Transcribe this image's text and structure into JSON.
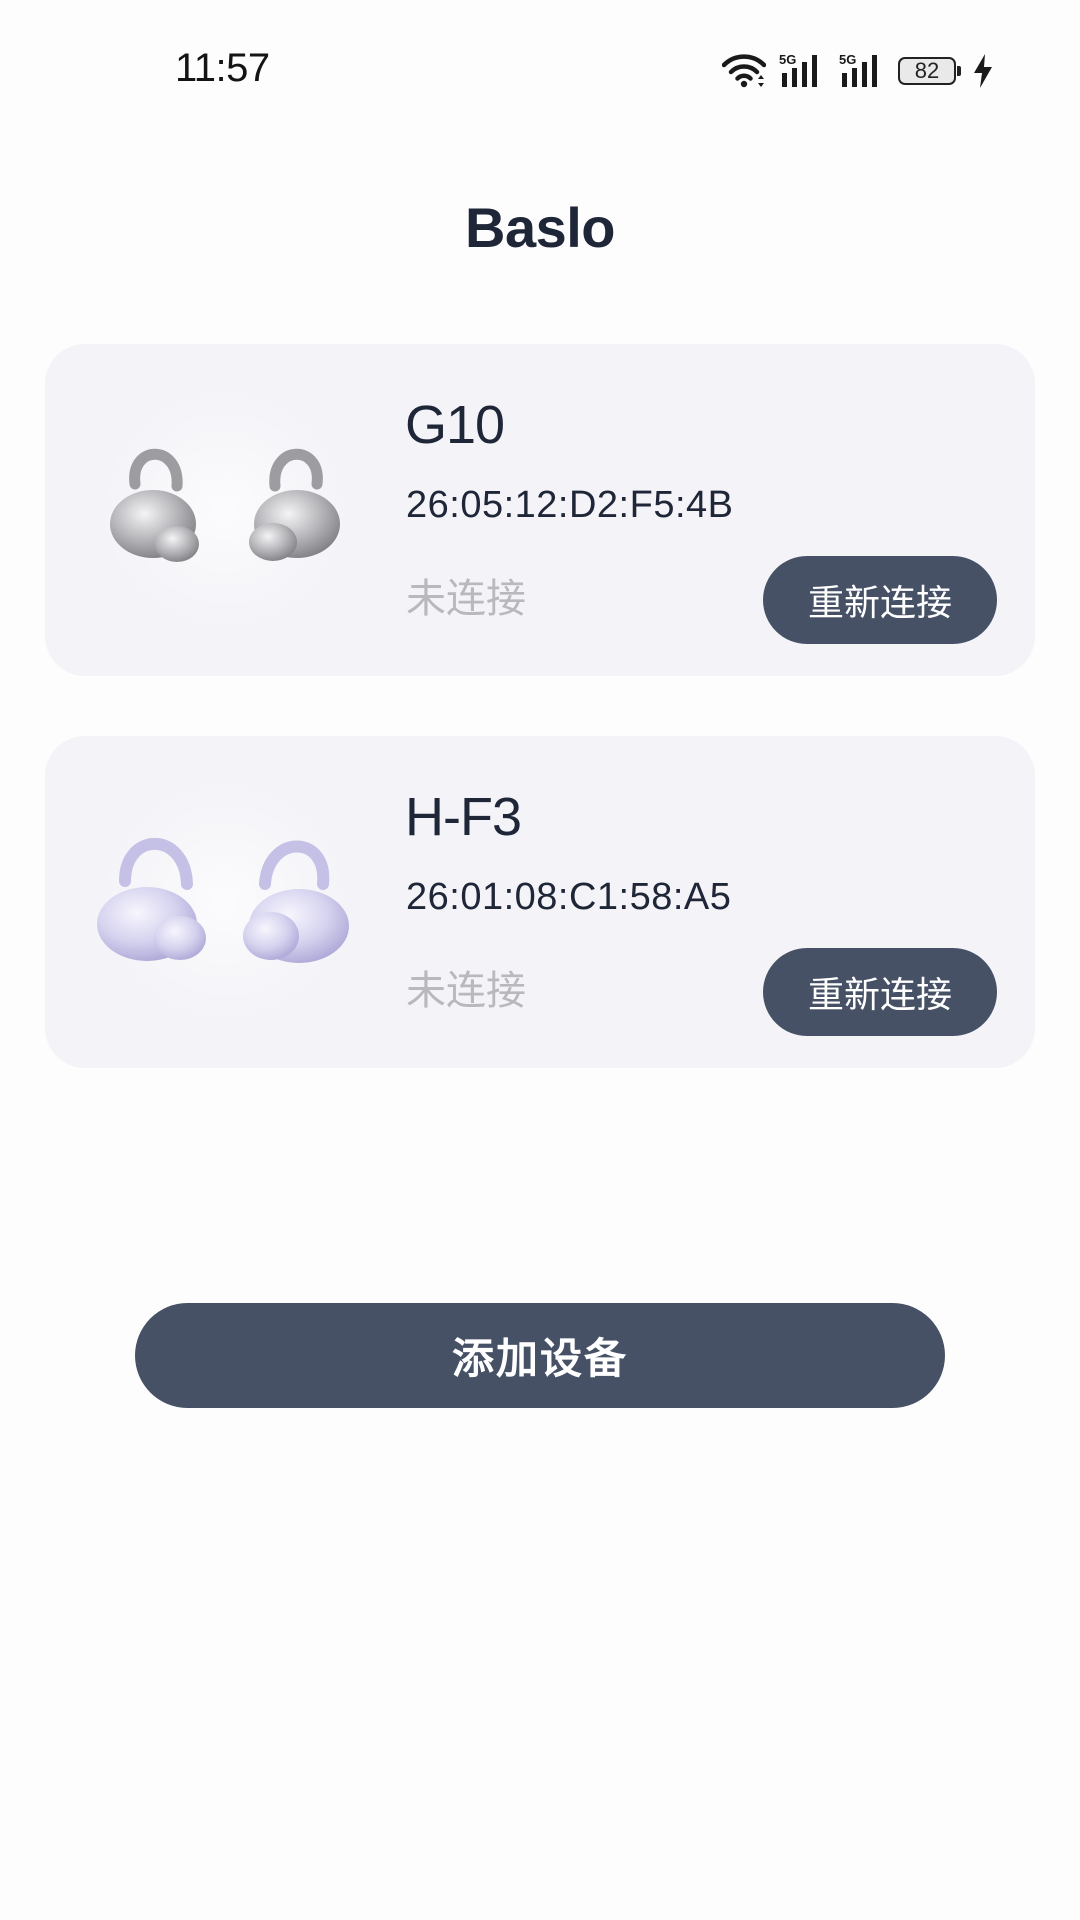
{
  "status_bar": {
    "time": "11:57",
    "signal_1_label": "5G",
    "signal_2_label": "5G",
    "battery_level": "82",
    "icons": [
      "wifi-icon",
      "signal-5g-icon",
      "signal-5g-icon",
      "battery-icon",
      "charging-icon"
    ]
  },
  "app": {
    "title": "Baslo"
  },
  "devices": [
    {
      "name": "G10",
      "mac": "26:05:12:D2:F5:4B",
      "status": "未连接",
      "button_label": "重新连接",
      "image": "silver-earbuds-image",
      "image_color": "#a9a9ad"
    },
    {
      "name": "H-F3",
      "mac": "26:01:08:C1:58:A5",
      "status": "未连接",
      "button_label": "重新连接",
      "image": "lavender-earbuds-image",
      "image_color": "#cfcdea"
    }
  ],
  "add_device": {
    "label": "添加设备"
  },
  "colors": {
    "background": "#fdfdfe",
    "card": "#f3f3f8",
    "accent_button": "#465166",
    "text_primary": "#1f2637",
    "text_muted": "#b8b8bd"
  }
}
